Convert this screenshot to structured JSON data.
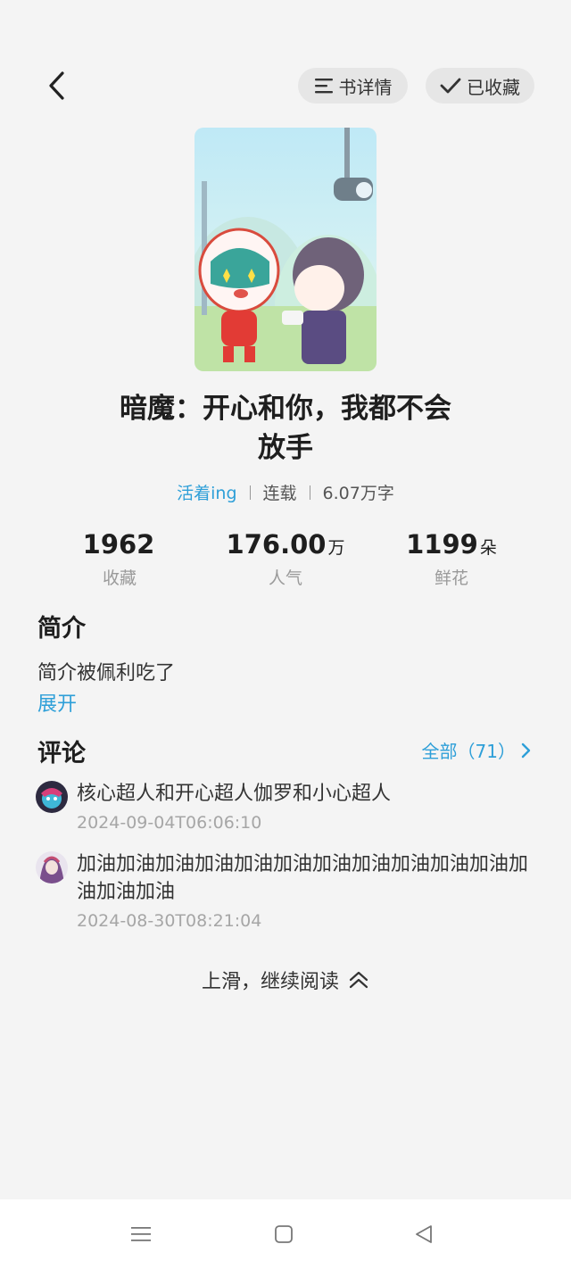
{
  "header": {
    "detail_label": "书详情",
    "favorite_label": "已收藏"
  },
  "book": {
    "title_line1": "暗魔：开心和你，我都不会",
    "title_line2": "放手",
    "author": "活着ing",
    "status": "连载",
    "word_count": "6.07万字"
  },
  "stats": [
    {
      "value": "1962",
      "unit": "",
      "label": "收藏"
    },
    {
      "value": "176.00",
      "unit": "万",
      "label": "人气"
    },
    {
      "value": "1199",
      "unit": "朵",
      "label": "鲜花"
    }
  ],
  "intro": {
    "heading": "简介",
    "text": "简介被佩利吃了",
    "expand_label": "展开"
  },
  "comments": {
    "heading": "评论",
    "all_label": "全部（71）",
    "items": [
      {
        "text": "核心超人和开心超人伽罗和小心超人",
        "time": "2024-09-04T06:06:10"
      },
      {
        "text": "加油加油加油加油加油加油加油加油加油加油加油加油加油加油",
        "time": "2024-08-30T08:21:04"
      }
    ]
  },
  "footer": {
    "continue_label": "上滑，继续阅读"
  },
  "colors": {
    "accent": "#2e9fd8",
    "background": "#f4f4f4"
  },
  "icons": {
    "back": "chevron-left-icon",
    "detail": "list-icon",
    "favorite": "check-icon",
    "more": "chevron-right-icon",
    "continue": "double-chevron-up-icon"
  }
}
